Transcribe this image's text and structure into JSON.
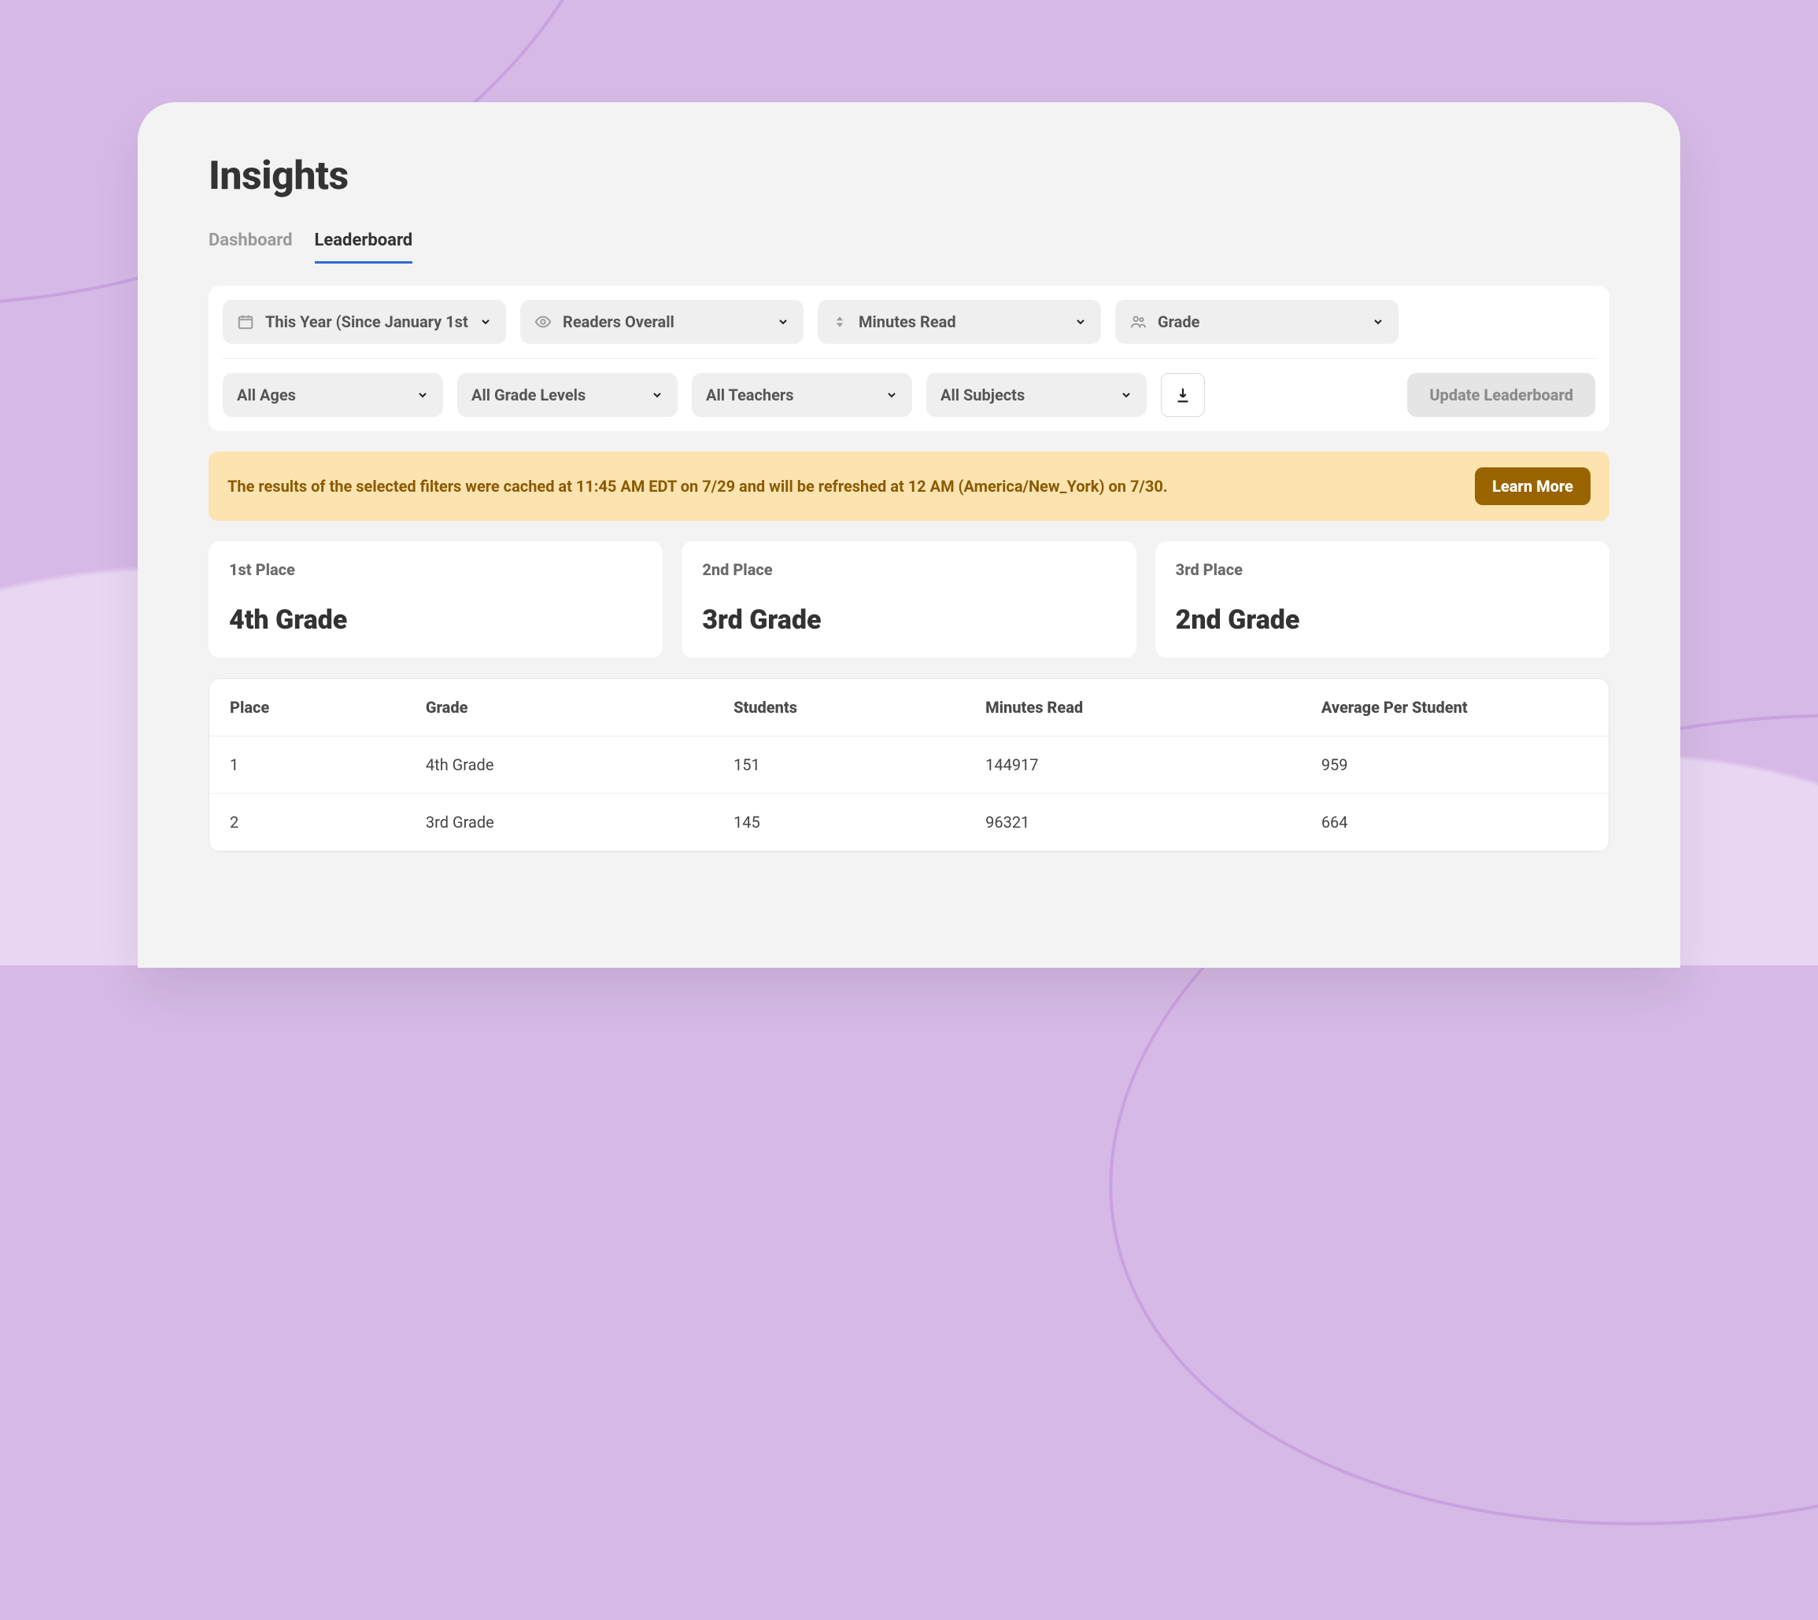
{
  "header": {
    "title": "Insights"
  },
  "tabs": {
    "dashboard": "Dashboard",
    "leaderboard": "Leaderboard",
    "active": "leaderboard"
  },
  "filters": {
    "period": {
      "label": "This Year (Since January 1st"
    },
    "readers": {
      "label": "Readers Overall"
    },
    "metric": {
      "label": "Minutes Read"
    },
    "groupby": {
      "label": "Grade"
    },
    "ages": {
      "label": "All Ages"
    },
    "grades": {
      "label": "All Grade Levels"
    },
    "teachers": {
      "label": "All Teachers"
    },
    "subjects": {
      "label": "All Subjects"
    },
    "update_label": "Update Leaderboard"
  },
  "banner": {
    "text": "The results of the selected filters were cached at 11:45 AM EDT on 7/29 and will be refreshed at 12 AM (America/New_York) on 7/30.",
    "learn_more": "Learn More"
  },
  "podium": [
    {
      "place": "1st Place",
      "value": "4th Grade"
    },
    {
      "place": "2nd Place",
      "value": "3rd Grade"
    },
    {
      "place": "3rd Place",
      "value": "2nd Grade"
    }
  ],
  "table": {
    "columns": {
      "place": "Place",
      "grade": "Grade",
      "students": "Students",
      "minutes": "Minutes Read",
      "avg": "Average Per Student"
    },
    "rows": [
      {
        "place": "1",
        "grade": "4th Grade",
        "students": "151",
        "minutes": "144917",
        "avg": "959"
      },
      {
        "place": "2",
        "grade": "3rd Grade",
        "students": "145",
        "minutes": "96321",
        "avg": "664"
      }
    ]
  }
}
